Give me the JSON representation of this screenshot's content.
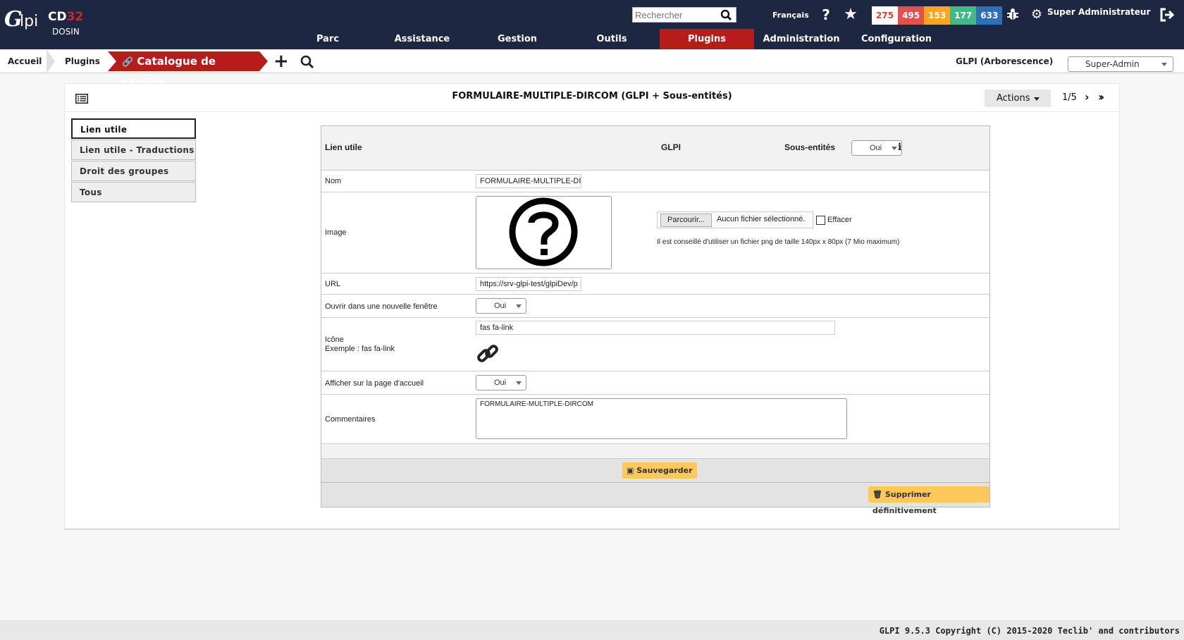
{
  "header": {
    "logo_text": "Glpi",
    "org_code": "CD",
    "org_num": "32",
    "org_name": "DOSIN",
    "search_placeholder": "Rechercher",
    "language": "Français",
    "counters": [
      {
        "value": "275",
        "color": "#ffffff",
        "text": "#e53935"
      },
      {
        "value": "495",
        "color": "#e05252",
        "text": "#ffffff"
      },
      {
        "value": "153",
        "color": "#f5a623",
        "text": "#ffffff"
      },
      {
        "value": "177",
        "color": "#43b885",
        "text": "#ffffff"
      },
      {
        "value": "633",
        "color": "#2e6fb5",
        "text": "#ffffff"
      }
    ],
    "user": "Super Administrateur"
  },
  "menu": [
    {
      "label": "Parc",
      "active": false
    },
    {
      "label": "Assistance",
      "active": false
    },
    {
      "label": "Gestion",
      "active": false
    },
    {
      "label": "Outils",
      "active": false
    },
    {
      "label": "Plugins",
      "active": true
    },
    {
      "label": "Administration",
      "active": false
    },
    {
      "label": "Configuration",
      "active": false
    }
  ],
  "breadcrumb": {
    "home": "Accueil",
    "plugins": "Plugins",
    "current": "Catalogue de service",
    "entity": "GLPI (Arborescence)",
    "profile": "Super-Admin"
  },
  "item": {
    "title": "FORMULAIRE-MULTIPLE-DIRCOM (GLPI + Sous-entités)",
    "actions_label": "Actions",
    "pager": "1/5"
  },
  "tabs": [
    {
      "label": "Lien utile",
      "active": true
    },
    {
      "label": "Lien utile - Traductions",
      "active": false
    },
    {
      "label": "Droit des groupes",
      "active": false
    },
    {
      "label": "Tous",
      "active": false
    }
  ],
  "form": {
    "head_label": "Lien utile",
    "head_entity": "GLPI",
    "head_sub_label": "Sous-entités",
    "head_sub_value": "Oui",
    "name_label": "Nom",
    "name_value": "FORMULAIRE-MULTIPLE-DIRCOM",
    "image_label": "Image",
    "browse_label": "Parcourir...",
    "file_status": "Aucun fichier sélectionné.",
    "erase_label": "Effacer",
    "image_hint": "Il est conseillé d'utiliser un fichier png de taille 140px x 80px (7 Mio maximum)",
    "url_label": "URL",
    "url_value": "https://srv-glpi-test/glpiDev/p",
    "new_window_label": "Ouvrir dans une nouvelle fenêtre",
    "new_window_value": "Oui",
    "icon_label": "Icône",
    "icon_example": "Exemple : fas fa-link",
    "icon_value": "fas fa-link",
    "homepage_label": "Afficher sur la page d'accueil",
    "homepage_value": "Oui",
    "comments_label": "Commentaires",
    "comments_value": "FORMULAIRE-MULTIPLE-DIRCOM",
    "save_label": "Sauvegarder",
    "delete_label": "Supprimer définitivement"
  },
  "footer": "GLPI 9.5.3 Copyright (C) 2015-2020 Teclib' and contributors"
}
